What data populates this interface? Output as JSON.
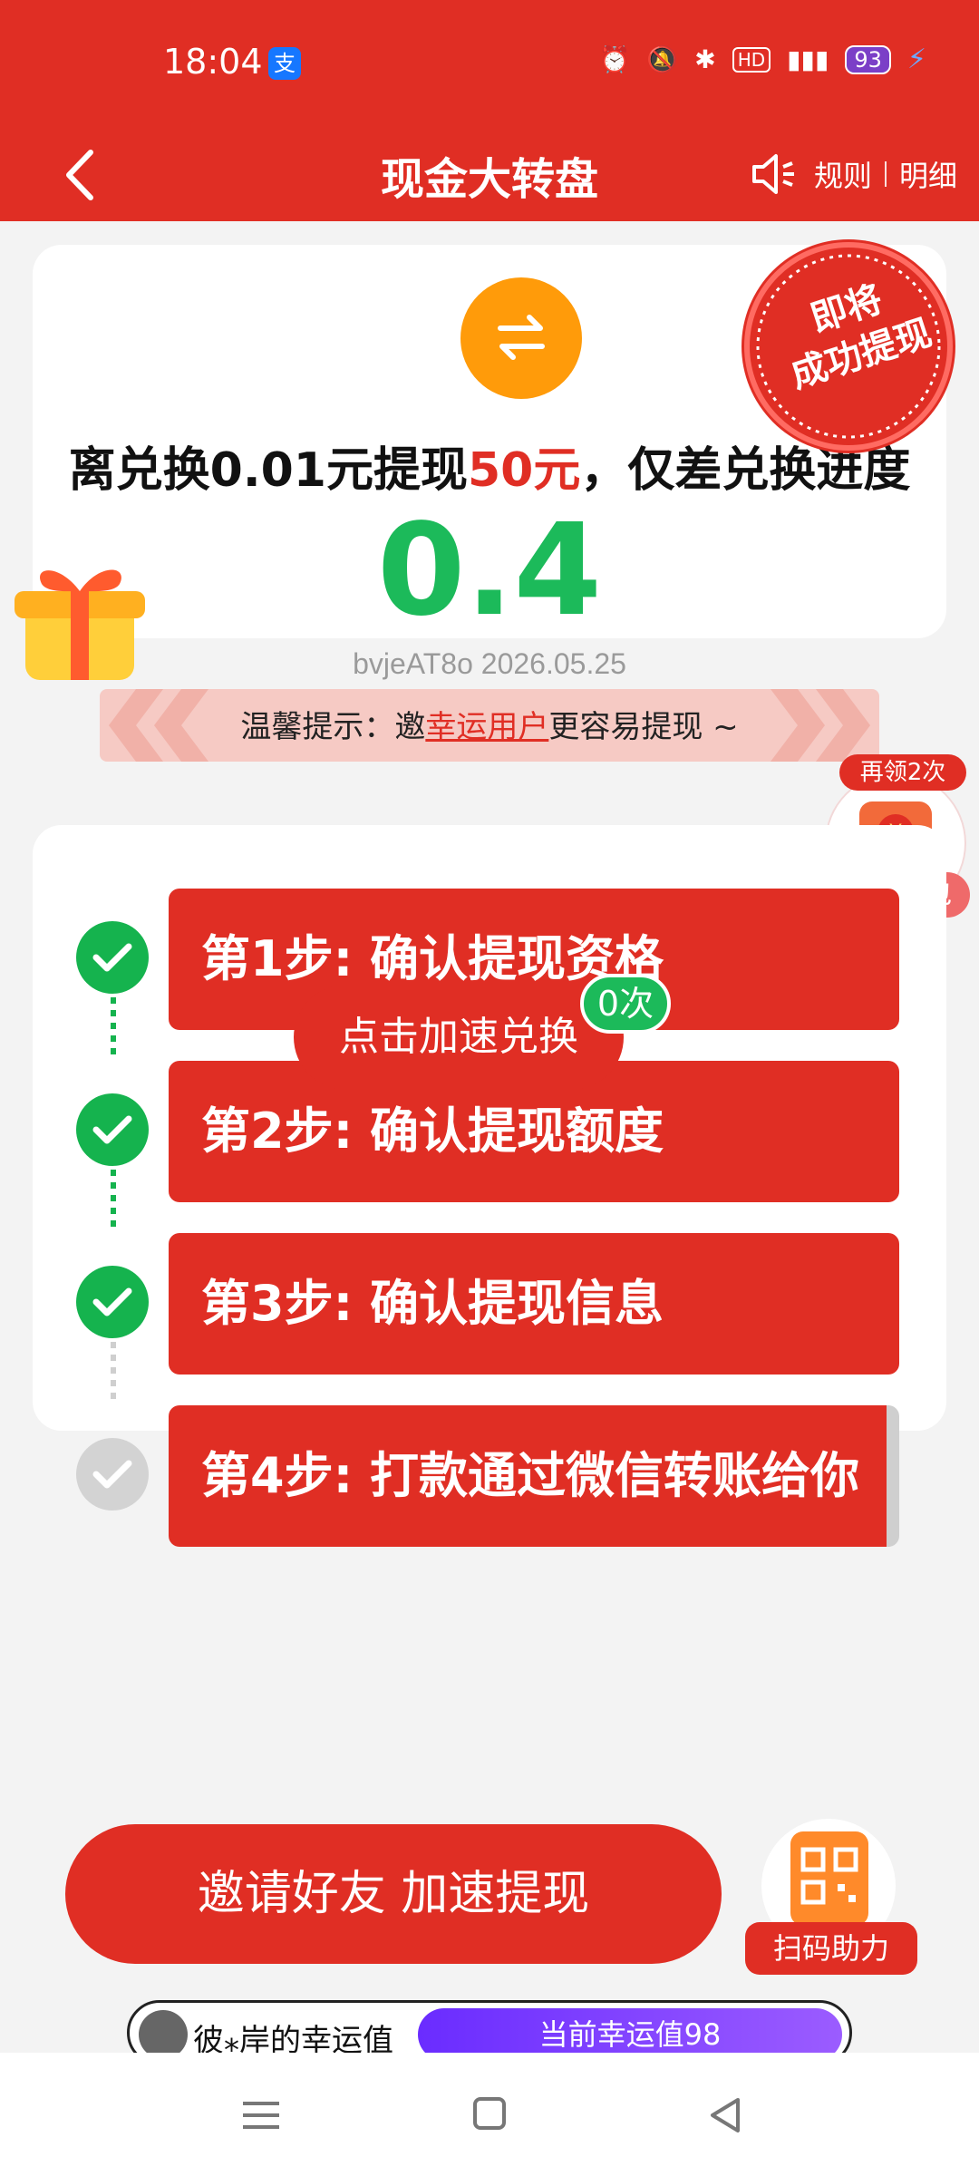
{
  "status_bar": {
    "time": "18:04",
    "app_icon": "支",
    "battery": "93"
  },
  "header": {
    "title": "现金大转盘",
    "rules_label": "规则",
    "details_label": "明细"
  },
  "top_card": {
    "progress_prefix": "离兑换0.01元提现",
    "progress_highlight": "50元",
    "progress_suffix": "，仅差兑换进度",
    "progress_value": "0.4",
    "stamp_line1": "即将",
    "stamp_line2": "成功提现"
  },
  "watermark": "bvjeAT8o 2026.05.25",
  "tip": {
    "prefix": "温馨提示：邀",
    "link": "幸运用户",
    "suffix": "更容易提现 ~"
  },
  "redpack": {
    "top_badge": "再领2次",
    "coin": "¥",
    "bottom_badge": "加速红包"
  },
  "steps": [
    {
      "label": "第1步: 确认提现资格",
      "done": true
    },
    {
      "label": "第2步: 确认提现额度",
      "done": true
    },
    {
      "label": "第3步: 确认提现信息",
      "done": true
    },
    {
      "label": "第4步: 打款通过微信转账给你",
      "done": false
    }
  ],
  "accelerate": {
    "label": "点击加速兑换",
    "count": "0次"
  },
  "invite": {
    "label": "邀请好友 加速提现"
  },
  "scan": {
    "label": "扫码助力"
  },
  "lucky": {
    "title": "彼⁎岸的幸运值",
    "value": "当前幸运值98"
  },
  "colors": {
    "brand_red": "#e02e24",
    "success_green": "#15b34e",
    "orange": "#ff9b0a",
    "purple": "#6a2cff"
  }
}
